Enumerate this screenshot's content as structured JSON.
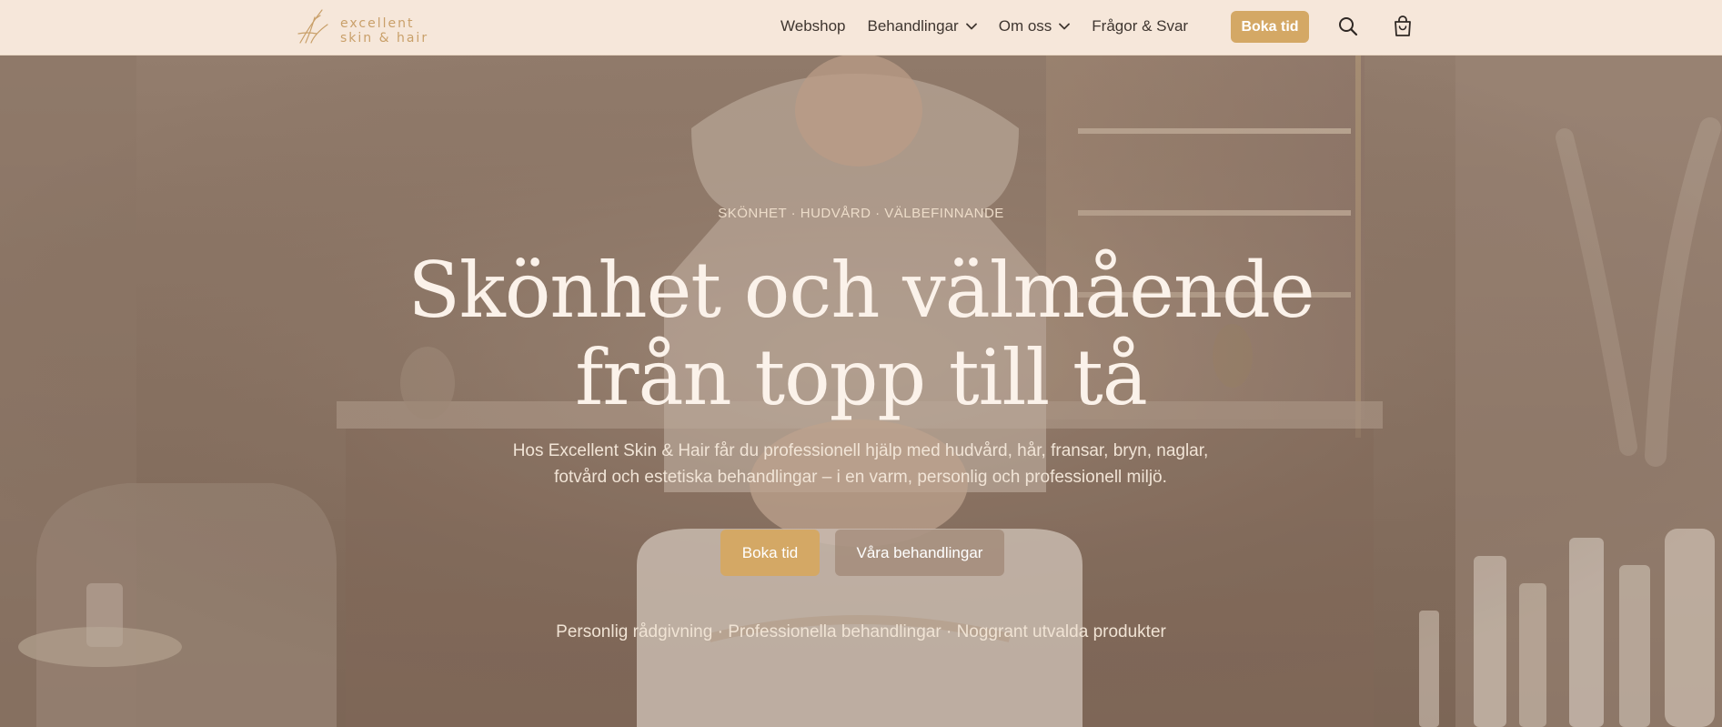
{
  "brand": {
    "logo_line1": "excellent",
    "logo_line2": "skin & hair",
    "logo_color": "#c9a06a",
    "accent_color": "#d4a865"
  },
  "nav": {
    "items": [
      {
        "label": "Webshop",
        "has_dropdown": false
      },
      {
        "label": "Behandlingar",
        "has_dropdown": true,
        "icon": "chevron-down-icon"
      },
      {
        "label": "Om oss",
        "has_dropdown": true,
        "icon": "chevron-down-icon"
      },
      {
        "label": "Frågor & Svar",
        "has_dropdown": false
      }
    ],
    "book_button": "Boka tid",
    "search_icon": "search-icon",
    "cart_icon": "shopping-bag-icon"
  },
  "hero": {
    "eyebrow": "SKÖNHET · HUDVÅRD · VÄLBEFINNANDE",
    "headline_line1": "Skönhet och välmående",
    "headline_line2": "från topp till tå",
    "lede": "Hos Excellent Skin & Hair får du professionell hjälp med hudvård, hår, fransar, bryn, naglar, fotvård och estetiska behandlingar – i en varm, personlig och professionell miljö.",
    "primary_cta": "Boka tid",
    "secondary_cta": "Våra behandlingar",
    "trustline": "Personlig rådgivning · Professionella behandlingar · Noggrant utvalda produkter"
  }
}
